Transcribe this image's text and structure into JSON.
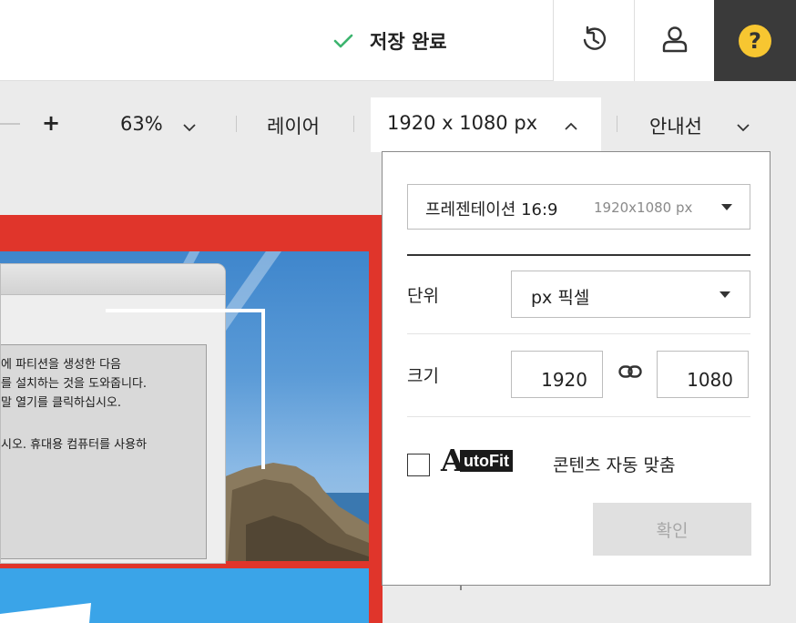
{
  "topbar": {
    "save_status": "저장 완료",
    "icons": {
      "check": "check-icon",
      "history": "history-icon",
      "user": "user-icon",
      "help": "help-icon"
    },
    "help_glyph": "?",
    "colors": {
      "check": "#3cb46e",
      "help_bg": "#3a3a3a",
      "help_circle": "#f7c631"
    }
  },
  "toolbar": {
    "zoom_in": "+",
    "zoom_value": "63%",
    "layer_label": "레이어",
    "size_label": "1920 x 1080 px",
    "guide_label": "안내선"
  },
  "canvas": {
    "dialog_lines": [
      "에 파티션을 생성한 다음",
      "를 설치하는 것을 도와줍니다.",
      "말 열기를 클릭하십시오.",
      "시오. 휴대용 컴퓨터를 사용하"
    ],
    "colors": {
      "background": "#e0352b",
      "panel": "#3aa4e8"
    }
  },
  "size_popup": {
    "preset": {
      "name": "프레젠테이션 16:9",
      "size": "1920x1080 px"
    },
    "unit_label": "단위",
    "unit_value": "px 픽셀",
    "size_label": "크기",
    "width": "1920",
    "height": "1080",
    "autofit": {
      "logo_A": "A",
      "logo_text": "utoFit",
      "label": "콘텐츠 자동 맞춤",
      "checked": false
    },
    "confirm_label": "확인"
  }
}
